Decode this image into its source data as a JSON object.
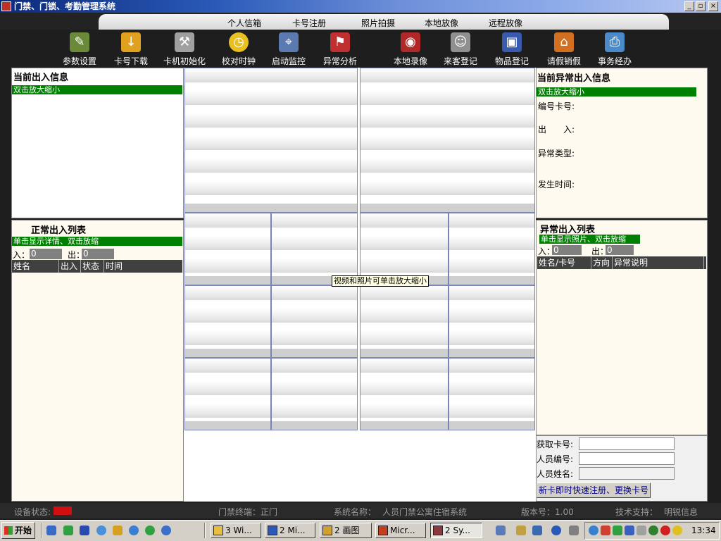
{
  "window": {
    "title": "门禁、门锁、考勤管理系统"
  },
  "menu": [
    "个人信箱",
    "卡号注册",
    "照片拍摄",
    "本地放像",
    "远程放像"
  ],
  "toolbar": [
    "参数设置",
    "卡号下载",
    "卡机初始化",
    "校对时钟",
    "启动监控",
    "异常分析",
    "本地录像",
    "来客登记",
    "物品登记",
    "请假销假",
    "事务经办"
  ],
  "current": {
    "title": "当前出入信息",
    "hint": "双击放大缩小"
  },
  "normal_list": {
    "title": "正常出入列表",
    "hint": "单击显示详情、双击放缩",
    "in_label": "入：",
    "in_value": "0",
    "out_label": "出：",
    "out_value": "0",
    "columns": [
      "姓名",
      "出入",
      "状态",
      "时间"
    ]
  },
  "abnormal_current": {
    "title": "当前异常出入信息",
    "hint": "双击放大缩小",
    "card_label": "编号卡号:",
    "inout_label": "出　　入:",
    "type_label": "异常类型:",
    "time_label": "发生时间:"
  },
  "abnormal_list": {
    "title": "异常出入列表",
    "hint": "单击显示照片、双击放缩",
    "in_label": "入：",
    "in_value": "0",
    "out_label": "出：",
    "out_value": "0",
    "columns": [
      "姓名/卡号",
      "方向",
      "异常说明"
    ]
  },
  "video": {
    "tooltip": "视频和照片可单击放大缩小"
  },
  "card_form": {
    "card_label": "获取卡号:",
    "id_label": "人员编号:",
    "name_label": "人员姓名:",
    "button": "新卡即时快速注册、更换卡号"
  },
  "status": {
    "device_label": "设备状态:",
    "terminal": "门禁终端：正门",
    "system_label": "系统名称：",
    "system_name": "人员门禁公寓住宿系统",
    "version": "版本号：1.00",
    "support_label": "技术支持：",
    "support_name": "明锐信息"
  },
  "taskbar": {
    "start": "开始",
    "tasks": [
      "3 Wi...",
      "2 Mi...",
      "2 画图",
      "Micr...",
      "2 Sy..."
    ],
    "clock": "13:34"
  },
  "colors": {
    "green": "#008000",
    "panel": "#fffaf0",
    "dark": "#1e1e1e"
  }
}
